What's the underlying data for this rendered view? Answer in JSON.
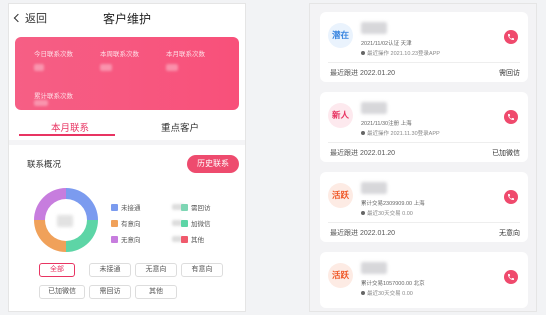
{
  "left": {
    "back_label": "返回",
    "title": "客户维护",
    "stats": [
      {
        "label": "今日联系次数"
      },
      {
        "label": "本周联系次数"
      },
      {
        "label": "本月联系次数"
      },
      {
        "label": "累计联系次数"
      }
    ],
    "tabs": [
      "本月联系",
      "重点客户"
    ],
    "section_title": "联系概况",
    "history_button": "历史联系",
    "legend": [
      {
        "label": "未接通",
        "color": "#7b9bef"
      },
      {
        "label": "需回访",
        "color": "#7ed6b4"
      },
      {
        "label": "有意向",
        "color": "#f0a15a"
      },
      {
        "label": "加微信",
        "color": "#5dd5a6"
      },
      {
        "label": "无意向",
        "color": "#c77dde"
      },
      {
        "label": "其他",
        "color": "#f05a6c"
      }
    ],
    "filters": [
      "全部",
      "未接通",
      "无意向",
      "有意向",
      "已加微信",
      "需回访",
      "其他"
    ]
  },
  "right": {
    "cards": [
      {
        "badge": "潜在",
        "badge_color": "#3a86e0",
        "badge_bg": "#eaf3fd",
        "info": "2021/11/02认证  天津",
        "op": "最近操作 2021.10.23登录APP",
        "follow": "最近跟进 2022.01.20",
        "status": "需回访"
      },
      {
        "badge": "新人",
        "badge_color": "#e83462",
        "badge_bg": "#fde9ee",
        "info": "2021/11/30注册  上海",
        "op": "最近操作 2021.11.30登录APP",
        "follow": "最近跟进 2022.01.20",
        "status": "已加微信"
      },
      {
        "badge": "活跃",
        "badge_color": "#f05a2a",
        "badge_bg": "#fdebe4",
        "info": "累计交易2309909.00  上海",
        "op": "最近30天交易 0.00",
        "follow": "最近跟进 2022.01.20",
        "status": "无意向"
      },
      {
        "badge": "活跃",
        "badge_color": "#f05a2a",
        "badge_bg": "#fdebe4",
        "info": "累计交易1057000.00  北京",
        "op": "最近30天交易 0.00",
        "follow": "",
        "status": ""
      }
    ]
  }
}
